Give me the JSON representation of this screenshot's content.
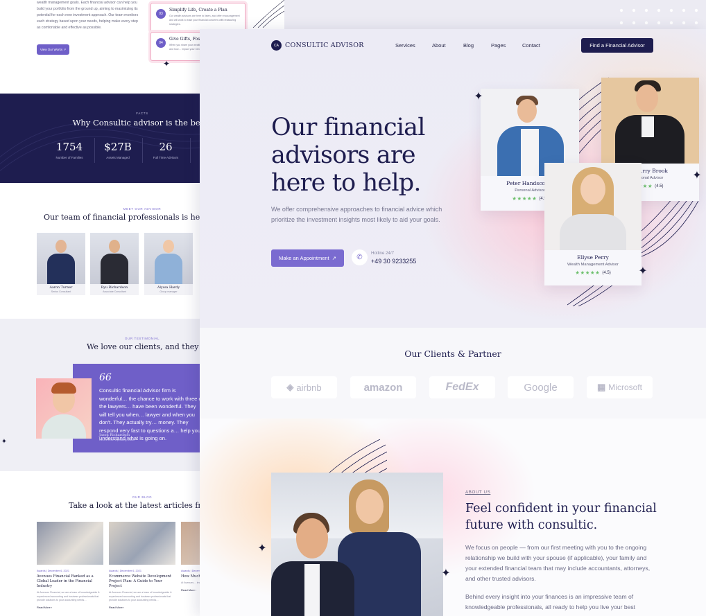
{
  "back_page": {
    "intro": {
      "text": "wealth management goals. Each financial advisor can help you build your portfolio from the ground up, aiming to maximizing its potential for each new investment approach. Our team monitors each strategy based upon your needs, helping make every step as comfortable and effective as possible.",
      "button_label": "View Our Works ↗",
      "steps": [
        {
          "num": "03",
          "title": "Simplify Life, Create a Plan",
          "text": "Our wealth advisors are here to listen, and offer encouragement and will work to ease your financial concerns with reassuring strategies."
        },
        {
          "num": "04",
          "title": "Give Gifts, Foster Gr…",
          "text": "When you share your wealth with family… about your priorities and how… impact your beneficiaries…"
        }
      ]
    },
    "facts": {
      "tag": "FACTS",
      "title": "Why Consultic advisor is the best?",
      "stats": [
        {
          "value": "1754",
          "label": "Number of Families"
        },
        {
          "value": "$27B",
          "label": "Assets Managed"
        },
        {
          "value": "26",
          "label": "Full Time Advisors"
        }
      ]
    },
    "team": {
      "tag": "MEET OUR ADVISOR",
      "title": "Our team of financial professionals is helping you a…",
      "members": [
        {
          "name": "Aaron Turner",
          "role": "Senior Consultant"
        },
        {
          "name": "Ryu Richardson",
          "role": "Associate Consultant"
        },
        {
          "name": "Alyssa Hardy",
          "role": "Group manager"
        }
      ]
    },
    "testimonial": {
      "tag": "OUR TESTIMONIAL",
      "title": "We love our clients, and they love us.",
      "quote_mark": "66",
      "text": "Consultic financial Advisor firm is wonderful… the chance to work with three of the lawyers… have been wonderful. They will tell you when… lawyer and when you don't. They actually try… money. They respond very fast to questions a… help you understand what is going on.",
      "name": "Jason Richardson",
      "role": "CEO & Chief Operating Officer"
    },
    "blog": {
      "tag": "OUR BLOG",
      "title": "Take a look at the latest articles from Cons…",
      "posts": [
        {
          "meta": "Awards  |  December 6, 2021",
          "title": "Avenues Financial Ranked as a Global Leader in the Financial Industry",
          "text": "At Avenues Financial, we are a team of knowledgeable & experienced accounting and business professionals that provide solutions to your accounting needs…",
          "more": "Read More ›"
        },
        {
          "meta": "Awards  |  December 6, 2021",
          "title": "Ecommerce Website Development Project Plan: A Guide to Your Project",
          "text": "At Avenues Financial, we are a team of knowledgeable & experienced accounting and business professionals that provide solutions to your accounting needs…",
          "more": "Read More ›"
        },
        {
          "meta": "Awards  |  December…",
          "title": "How Much… Set the Rig…",
          "text": "At Avenues… knowledgeab… and busines… solutions to…",
          "more": "Read More ›"
        }
      ]
    }
  },
  "header": {
    "logo_mark": "CA",
    "logo_text": "CONSULTIC ADVISOR",
    "nav": [
      "Services",
      "About",
      "Blog",
      "Pages",
      "Contact"
    ],
    "cta": "Find a Financial Advisor"
  },
  "hero": {
    "headline": "Our financial advisors are here to help.",
    "subtext": "We offer comprehensive approaches to financial advice which prioritize the investment insights most likely to aid your goals.",
    "button_label": "Make an Appointment",
    "hotline_label": "Hotline 24/7",
    "hotline_number": "+49 30 9233255",
    "advisors": [
      {
        "name": "Peter Handscomb",
        "role": "Personal Advisor",
        "rating": "(4.5)"
      },
      {
        "name": "…rry Brook",
        "role": "…onal Advisor",
        "rating": "(4.5)"
      },
      {
        "name": "Ellyse Perry",
        "role": "Wealth Management Advisor",
        "rating": "(4.5)"
      }
    ]
  },
  "clients": {
    "title": "Our Clients & Partner",
    "logos": [
      "airbnb",
      "amazon",
      "FedEx",
      "Google",
      "Microsoft"
    ]
  },
  "about": {
    "tag": "ABOUT US",
    "headline": "Feel confident in your financial future with consultic.",
    "paragraph1": "We focus on people — from our first meeting with you to the ongoing relationship we build with your spouse (if applicable), your family and your extended financial team that may include accountants, attorneys, and other trusted advisors.",
    "paragraph2": "Behind every insight into your finances is an impressive team of knowledgeable professionals, all ready to help you live your best"
  },
  "icons": {
    "sparkle": "sparkle-icon",
    "phone": "phone-icon",
    "arrow": "arrow-up-right-icon"
  },
  "colors": {
    "navy": "#1e1d4f",
    "accent": "#7a6bd0",
    "star_green": "#6cbf6b"
  }
}
